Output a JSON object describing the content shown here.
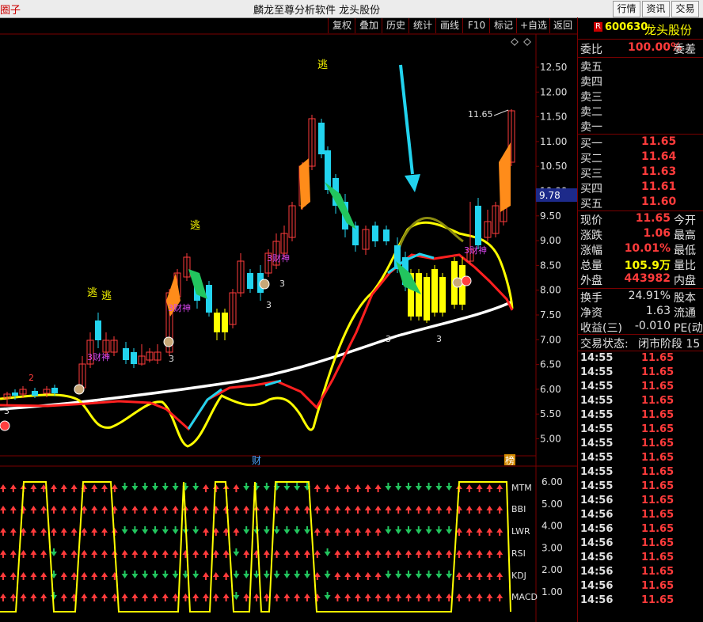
{
  "window": {
    "left_label": "圈子",
    "title": "麟龙至尊分析软件   龙头股份",
    "buttons": [
      "行情",
      "资讯",
      "交易"
    ]
  },
  "toolbar": {
    "items": [
      "复权",
      "叠加",
      "历史",
      "统计",
      "画线",
      "F10",
      "标记",
      "+自选",
      "返回"
    ]
  },
  "chart": {
    "price_axis": [
      "12.50",
      "12.00",
      "11.50",
      "11.00",
      "10.50",
      "10.00",
      "9.50",
      "9.00",
      "8.50",
      "8.00",
      "7.50",
      "7.00",
      "6.50",
      "6.00",
      "5.50",
      "5.00"
    ],
    "cursor_price": "9.78",
    "high_label": "11.65",
    "annotations": {
      "escape": "逃",
      "god_of_wealth": "3财神",
      "three": "3",
      "two": "2",
      "cai": "财",
      "bang": "榜"
    },
    "indicator_axis": [
      "6.00",
      "5.00",
      "4.00",
      "3.00",
      "2.00",
      "1.00"
    ],
    "indicator_labels": [
      "MTM",
      "BBI",
      "LWR",
      "RSI",
      "KDJ",
      "MACD"
    ]
  },
  "quote": {
    "badge": "R",
    "code": "600630",
    "name": "龙头股份",
    "weibi_label": "委比",
    "weibi_value": "100.00%",
    "weicha_label": "委差",
    "sell": [
      {
        "label": "卖五",
        "price": ""
      },
      {
        "label": "卖四",
        "price": ""
      },
      {
        "label": "卖三",
        "price": ""
      },
      {
        "label": "卖二",
        "price": ""
      },
      {
        "label": "卖一",
        "price": ""
      }
    ],
    "buy": [
      {
        "label": "买一",
        "price": "11.65"
      },
      {
        "label": "买二",
        "price": "11.64"
      },
      {
        "label": "买三",
        "price": "11.63"
      },
      {
        "label": "买四",
        "price": "11.61"
      },
      {
        "label": "买五",
        "price": "11.60"
      }
    ],
    "stats": [
      {
        "l1": "现价",
        "v1": "11.65",
        "l2": "今开"
      },
      {
        "l1": "涨跌",
        "v1": "1.06",
        "l2": "最高"
      },
      {
        "l1": "涨幅",
        "v1": "10.01%",
        "l2": "最低"
      },
      {
        "l1": "总量",
        "v1": "105.9万",
        "l2": "量比"
      },
      {
        "l1": "外盘",
        "v1": "443982",
        "l2": "内盘"
      }
    ],
    "stats2": [
      {
        "l1": "换手",
        "v1": "24.91%",
        "l2": "股本"
      },
      {
        "l1": "净资",
        "v1": "1.63",
        "l2": "流通"
      },
      {
        "l1": "收益(三)",
        "v1": "-0.010",
        "l2": "PE(动"
      }
    ],
    "status_label": "交易状态:",
    "status_value": "闭市阶段 15",
    "ticks": [
      {
        "time": "14:55",
        "price": "11.65"
      },
      {
        "time": "14:55",
        "price": "11.65"
      },
      {
        "time": "14:55",
        "price": "11.65"
      },
      {
        "time": "14:55",
        "price": "11.65"
      },
      {
        "time": "14:55",
        "price": "11.65"
      },
      {
        "time": "14:55",
        "price": "11.65"
      },
      {
        "time": "14:55",
        "price": "11.65"
      },
      {
        "time": "14:55",
        "price": "11.65"
      },
      {
        "time": "14:55",
        "price": "11.65"
      },
      {
        "time": "14:55",
        "price": "11.65"
      },
      {
        "time": "14:56",
        "price": "11.65"
      },
      {
        "time": "14:56",
        "price": "11.65"
      },
      {
        "time": "14:56",
        "price": "11.65"
      },
      {
        "time": "14:56",
        "price": "11.65"
      },
      {
        "time": "14:56",
        "price": "11.65"
      },
      {
        "time": "14:56",
        "price": "11.65"
      },
      {
        "time": "14:56",
        "price": "11.65"
      },
      {
        "time": "14:56",
        "price": "11.65"
      }
    ]
  },
  "colors": {
    "up": "#ff3b3b",
    "down": "#22d3ee",
    "yellow": "#ffff00",
    "frame": "#7a0000"
  }
}
